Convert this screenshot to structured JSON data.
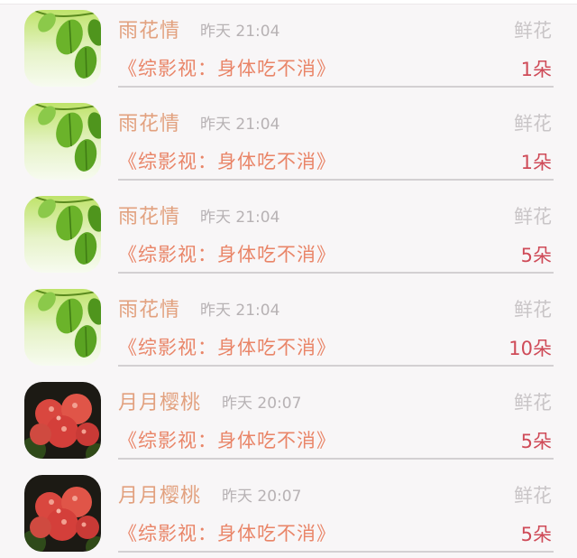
{
  "colors": {
    "name": "#e2a17f",
    "time": "#b7b2b4",
    "gift": "#c9c5c7",
    "book": "#e98568",
    "count": "#cf4b58",
    "divider": "#d3d0d2"
  },
  "entries": [
    {
      "avatar": "green-leaf-avatar",
      "name": "雨花情",
      "time": "昨天 21:04",
      "gift_label": "鲜花",
      "book": "《综影视：身体吃不消》",
      "count": "1朵"
    },
    {
      "avatar": "green-leaf-avatar",
      "name": "雨花情",
      "time": "昨天 21:04",
      "gift_label": "鲜花",
      "book": "《综影视：身体吃不消》",
      "count": "1朵"
    },
    {
      "avatar": "green-leaf-avatar",
      "name": "雨花情",
      "time": "昨天 21:04",
      "gift_label": "鲜花",
      "book": "《综影视：身体吃不消》",
      "count": "5朵"
    },
    {
      "avatar": "green-leaf-avatar",
      "name": "雨花情",
      "time": "昨天 21:04",
      "gift_label": "鲜花",
      "book": "《综影视：身体吃不消》",
      "count": "10朵"
    },
    {
      "avatar": "red-flower-avatar",
      "name": "月月樱桃",
      "time": "昨天 20:07",
      "gift_label": "鲜花",
      "book": "《综影视：身体吃不消》",
      "count": "5朵"
    },
    {
      "avatar": "red-flower-avatar",
      "name": "月月樱桃",
      "time": "昨天 20:07",
      "gift_label": "鲜花",
      "book": "《综影视：身体吃不消》",
      "count": "5朵"
    }
  ]
}
